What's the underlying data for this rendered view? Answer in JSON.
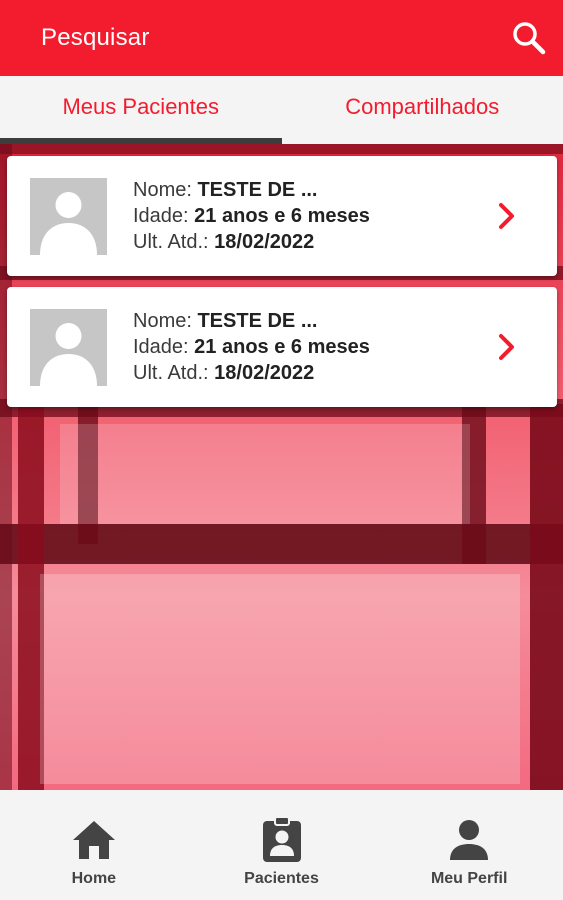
{
  "header": {
    "title": "Pesquisar",
    "search_icon": "search-icon"
  },
  "tabs": [
    {
      "label": "Meus Pacientes",
      "active": true
    },
    {
      "label": "Compartilhados",
      "active": false
    }
  ],
  "patients": [
    {
      "name_label": "Nome: ",
      "name": "TESTE DE ...",
      "age_label": "Idade: ",
      "age": "21 anos e 6 meses",
      "last_label": "Ult. Atd.: ",
      "last": "18/02/2022"
    },
    {
      "name_label": "Nome: ",
      "name": "TESTE DE ...",
      "age_label": "Idade: ",
      "age": "21 anos e 6 meses",
      "last_label": "Ult. Atd.: ",
      "last": "18/02/2022"
    }
  ],
  "bottom_nav": [
    {
      "label": "Home",
      "icon": "home-icon"
    },
    {
      "label": "Pacientes",
      "icon": "clipboard-user-icon"
    },
    {
      "label": "Meu Perfil",
      "icon": "person-icon"
    }
  ],
  "colors": {
    "primary": "#f31c2e",
    "tab_indicator": "#3d3d3d",
    "nav_text": "#444444",
    "avatar_placeholder": "#c6c6c6"
  }
}
